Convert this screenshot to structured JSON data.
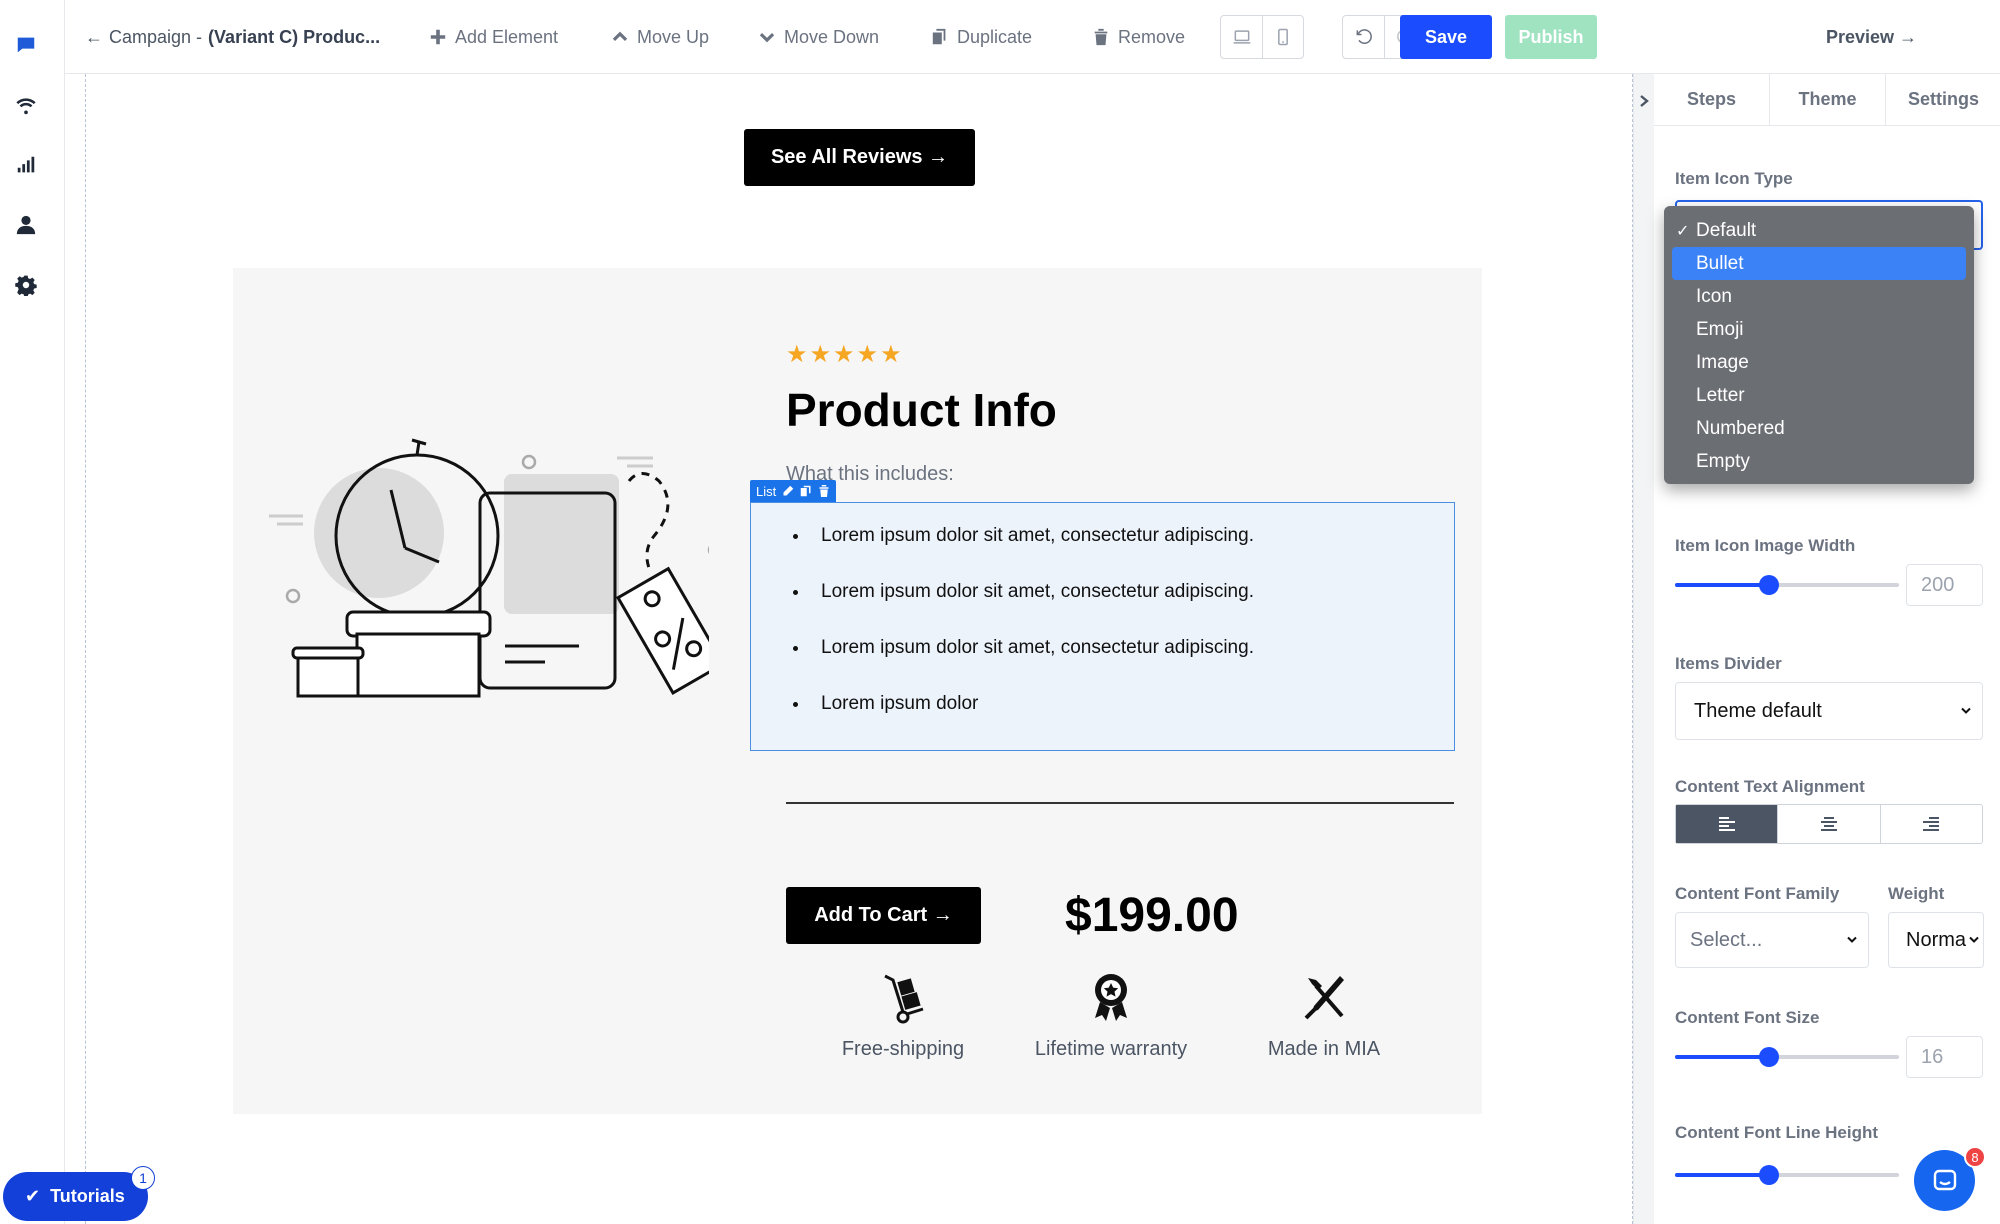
{
  "toolbar": {
    "breadcrumb_arrow": "←",
    "breadcrumb_label": "Campaign -",
    "breadcrumb_title": "(Variant C) Produc...",
    "add_element": "Add Element",
    "move_up": "Move Up",
    "move_down": "Move Down",
    "duplicate": "Duplicate",
    "remove": "Remove",
    "save": "Save",
    "publish": "Publish",
    "preview": "Preview →"
  },
  "canvas": {
    "see_all_reviews": "See All Reviews →",
    "stars": "★★★★★",
    "product_title": "Product Info",
    "includes_label": "What this includes:",
    "list_tag": "List",
    "list_items": [
      "Lorem ipsum dolor sit amet, consectetur adipiscing.",
      "Lorem ipsum dolor sit amet, consectetur adipiscing.",
      "Lorem ipsum dolor sit amet, consectetur adipiscing.",
      "Lorem ipsum dolor"
    ],
    "add_to_cart": "Add To Cart →",
    "price": "$199.00",
    "features": [
      "Free-shipping",
      "Lifetime warranty",
      "Made in MIA"
    ]
  },
  "panel": {
    "tabs": [
      "Steps",
      "Theme",
      "Settings"
    ],
    "item_icon_type_label": "Item Icon Type",
    "icon_type_options": [
      "Default",
      "Bullet",
      "Icon",
      "Emoji",
      "Image",
      "Letter",
      "Numbered",
      "Empty"
    ],
    "icon_type_selected": "Default",
    "icon_type_highlighted": "Bullet",
    "item_icon_image_width_label": "Item Icon Image Width",
    "item_icon_image_width_value": "200",
    "item_icon_image_width_fraction": 0.42,
    "items_divider_label": "Items Divider",
    "items_divider_value": "Theme default",
    "content_text_alignment_label": "Content Text Alignment",
    "content_font_family_label": "Content Font Family",
    "content_font_family_value": "Select...",
    "weight_label": "Weight",
    "weight_value": "Norma",
    "content_font_size_label": "Content Font Size",
    "content_font_size_value": "16",
    "content_font_size_fraction": 0.42,
    "content_font_line_height_label": "Content Font Line Height",
    "content_font_line_height_fraction": 0.42
  },
  "floating": {
    "tutorials": "Tutorials",
    "tutorials_badge": "1",
    "chat_badge": "8"
  },
  "colors": {
    "primary": "#1b4dff",
    "publish_disabled": "#9fe3c1",
    "star": "#f5a623",
    "selection_outline": "#4a90e2"
  }
}
